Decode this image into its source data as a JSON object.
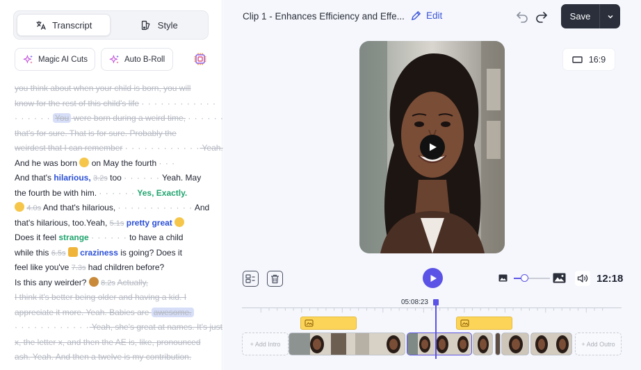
{
  "left_panel": {
    "tabs": [
      {
        "label": "Transcript",
        "icon": "translate-icon",
        "active": true
      },
      {
        "label": "Style",
        "icon": "style-icon",
        "active": false
      }
    ],
    "chips": [
      {
        "label": "Magic AI Cuts",
        "icon": "sparkle-icon"
      },
      {
        "label": "Auto B-Roll",
        "icon": "sparkle-icon"
      }
    ],
    "transcript": {
      "l1": "you think about when your child is born, you will",
      "l2a": "know for the rest of this child's life",
      "l2b": "· · · · · · · · · · · ·",
      "l3a": "· · · · · ·",
      "l3b": "You",
      "l3c": " were born during a weird time,",
      "l3d": "· · · · · ·",
      "l4": "that's for sure. That is for sure. Probably the",
      "l5a": "weirdest that I can remember",
      "l5b": "· · · · · · · · · · · ·",
      "l5c": " Yeah.",
      "l6a": "And he was born",
      "l6b": " on May the fourth",
      "l6c": "· · ·",
      "l7a": "And that's ",
      "l7b": "hilarious,",
      "l7c": "3.2s",
      "l7d": " too ",
      "l7e": "· · · · · ·",
      "l7f": " Yeah. May",
      "l8a": "the fourth be with him.",
      "l8b": "· · · · · ·",
      "l8c": "Yes, Exactly.",
      "l9a": "4.0s",
      "l9b": " And that's hilarious,",
      "l9c": "· · · · · · · · · · · ·",
      "l9d": " And",
      "l10a": "that's hilarious, too.Yeah,",
      "l10b": "5.1s",
      "l10c": "pretty great",
      "l11a": "Does it feel ",
      "l11b": "strange",
      "l11c": "· · · · · ·",
      "l11d": " to have a child",
      "l12a": "while this ",
      "l12b": "6.5s",
      "l12c": "craziness",
      "l12d": " is going? Does it",
      "l13a": "feel like you've ",
      "l13b": "7.3s",
      "l13c": " had children before?",
      "l14a": "Is this any weirder?",
      "l14b": "8.2s",
      "l14c": "Actually,",
      "l15": "I think it's better being older and having a kid. I",
      "l16a": "appreciate it more. Yeah. Babies are ",
      "l16b": "awesome.",
      "l17a": "· · · · · · · · · · · ·",
      "l17b": " Yeah, she's great at names. It's just",
      "l18": "x, the letter x, and then the AE is, like, pronounced",
      "l19": "ash. Yeah. And then a twelve is my contribution."
    }
  },
  "header": {
    "clip_title": "Clip 1 - Enhances Efficiency and Effe...",
    "edit_label": "Edit",
    "save_label": "Save"
  },
  "preview": {
    "aspect_ratio": "16:9"
  },
  "controls": {
    "duration": "12:18",
    "zoom_level": 0.3
  },
  "timeline": {
    "timecode": "05:08:23",
    "add_intro_label": "+ Add Intro",
    "add_outro_label": "+ Add Outro"
  },
  "colors": {
    "accent": "#5b53e6",
    "link_blue": "#3c55d8",
    "emphasis_blue": "#2b4fd6",
    "emphasis_green": "#20a46f",
    "save_bg": "#2a2f3b",
    "broll_yellow": "#fcd558"
  }
}
